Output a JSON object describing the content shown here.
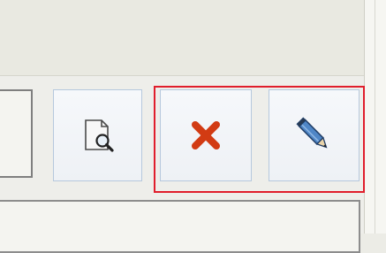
{
  "toolbar": {
    "buttons": [
      {
        "id": "view",
        "icon": "document-search-icon"
      },
      {
        "id": "delete",
        "icon": "delete-x-icon"
      },
      {
        "id": "edit",
        "icon": "pencil-icon"
      }
    ],
    "highlighted_group": [
      "delete",
      "edit"
    ]
  },
  "colors": {
    "highlight": "#e01e2c",
    "delete_icon": "#d23b13",
    "button_border": "#b6c8dd",
    "background": "#ecece6"
  }
}
